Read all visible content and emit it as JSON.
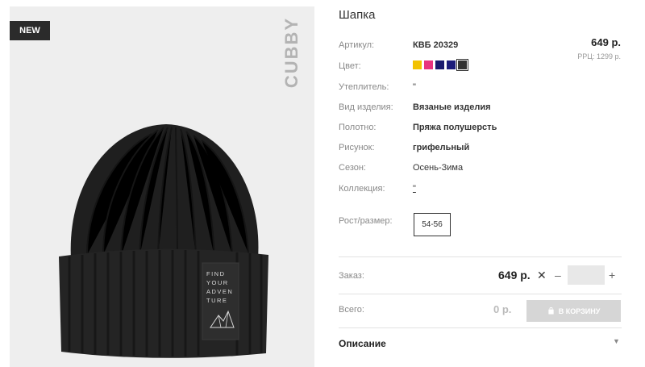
{
  "product": {
    "badge": "NEW",
    "brand": "CUBBY",
    "patch_text": [
      "FIND",
      "YOUR",
      "ADVEN",
      "TURE"
    ],
    "title": "Шапка",
    "price": "649 р.",
    "rrp": "РРЦ: 1299 р."
  },
  "specs": {
    "article_label": "Артикул:",
    "article_value": "КВБ 20329",
    "color_label": "Цвет:",
    "colors": [
      "#f2c200",
      "#e8337f",
      "#1a1a6e",
      "#1c1c7a",
      "#333333"
    ],
    "selected_color": 4,
    "insulation_label": "Утеплитель:",
    "insulation_value": "\"",
    "type_label": "Вид изделия:",
    "type_value": "Вязаные изделия",
    "fabric_label": "Полотно:",
    "fabric_value": "Пряжа полушерсть",
    "pattern_label": "Рисунок:",
    "pattern_value": "грифельный",
    "season_label": "Сезон:",
    "season_value": "Осень-Зима",
    "collection_label": "Коллекция:",
    "collection_value": "\"",
    "size_label": "Рост/размер:",
    "size_value": "54-56"
  },
  "order": {
    "label": "Заказ:",
    "price": "649 р.",
    "times": "✕",
    "minus": "–",
    "plus": "+",
    "quantity": "",
    "total_label": "Всего:",
    "total_value": "0 р.",
    "cart_button": "В КОРЗИНУ"
  },
  "description": {
    "label": "Описание",
    "chevron": "▼"
  }
}
